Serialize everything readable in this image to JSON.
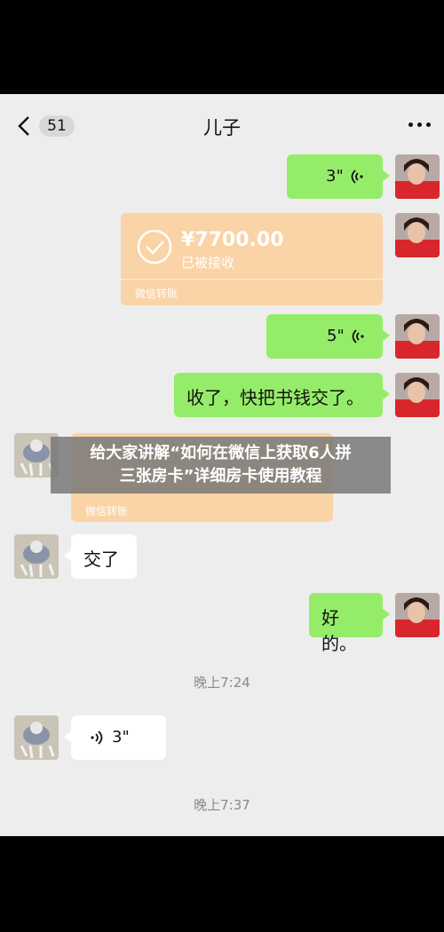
{
  "header": {
    "back_badge": "51",
    "title": "儿子"
  },
  "messages": {
    "voice_1": "3\"",
    "transfer_1": {
      "amount": "¥7700.00",
      "status": "已被接收",
      "footer": "微信转账"
    },
    "voice_2": "5\"",
    "text_1": "收了，快把书钱交了。",
    "transfer_2": {
      "footer": "微信转账"
    },
    "text_2": "交了",
    "text_3": "好的。",
    "time_1": "晚上7:24",
    "voice_3": "3\"",
    "time_2": "晚上7:37"
  },
  "overlay": {
    "line1": "给大家讲解“如何在微信上获取6人拼",
    "line2": "三张房卡”详细房卡使用教程"
  },
  "colors": {
    "chat_bg": "#ededed",
    "bubble_green": "#95ec69",
    "transfer_orange": "#fad3a6"
  },
  "icons": [
    "back-chevron-icon",
    "more-dots-icon",
    "voice-wave-icon",
    "check-circle-icon"
  ]
}
